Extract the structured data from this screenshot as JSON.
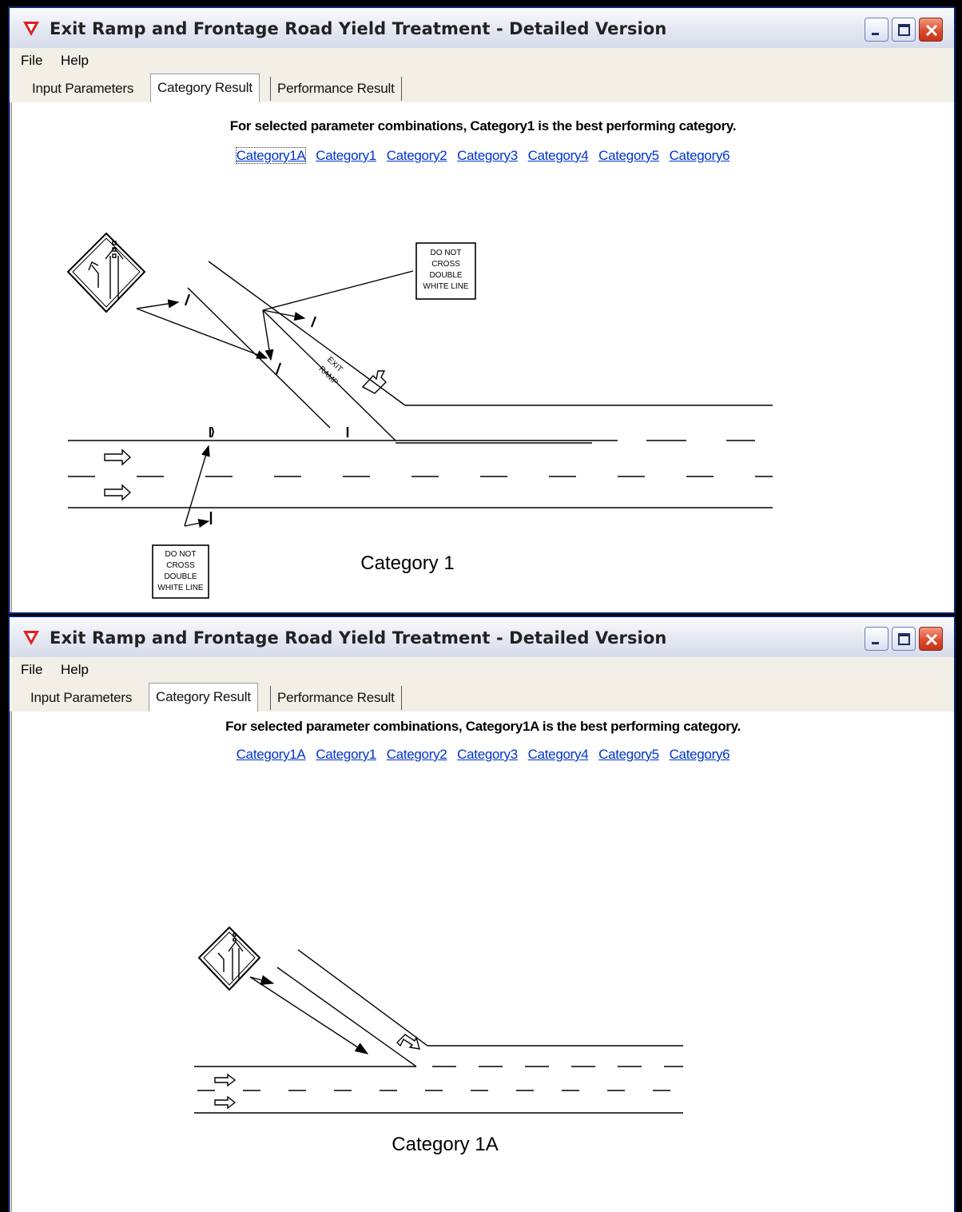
{
  "window1": {
    "title": "Exit Ramp and Frontage Road Yield Treatment - Detailed Version",
    "menu": [
      "File",
      "Help"
    ],
    "tabs": [
      "Input Parameters",
      "Category Result",
      "Performance Result"
    ],
    "selected_tab": "Category Result",
    "headline": "For selected parameter combinations, Category1 is the best performing category.",
    "category_links": [
      "Category1A",
      "Category1",
      "Category2",
      "Category3",
      "Category4",
      "Category5",
      "Category6"
    ],
    "focused_link": "Category1A",
    "diagram": {
      "caption": "Category 1",
      "sign_top": [
        "DO NOT",
        "CROSS",
        "DOUBLE",
        "WHITE LINE"
      ],
      "sign_bottom": [
        "DO NOT",
        "CROSS",
        "DOUBLE",
        "WHITE LINE"
      ],
      "ramp_label": [
        "EXIT",
        "RAMP"
      ]
    }
  },
  "window2": {
    "title": "Exit Ramp and Frontage Road Yield Treatment - Detailed Version",
    "menu": [
      "File",
      "Help"
    ],
    "tabs": [
      "Input Parameters",
      "Category Result",
      "Performance Result"
    ],
    "selected_tab": "Category Result",
    "headline": "For selected parameter combinations, Category1A is the best performing category.",
    "category_links": [
      "Category1A",
      "Category1",
      "Category2",
      "Category3",
      "Category4",
      "Category5",
      "Category6"
    ],
    "diagram": {
      "caption": "Category 1A"
    }
  },
  "colors": {
    "title_icon": "#e0201c",
    "link": "#0033cc",
    "close_button": "#d9482b"
  },
  "icons": {
    "app": "yield-triangle-icon",
    "minimize": "minimize-icon",
    "maximize": "maximize-icon",
    "close": "close-icon",
    "sign": "lane-merge-sign-icon",
    "arrow": "direction-arrow-icon"
  }
}
